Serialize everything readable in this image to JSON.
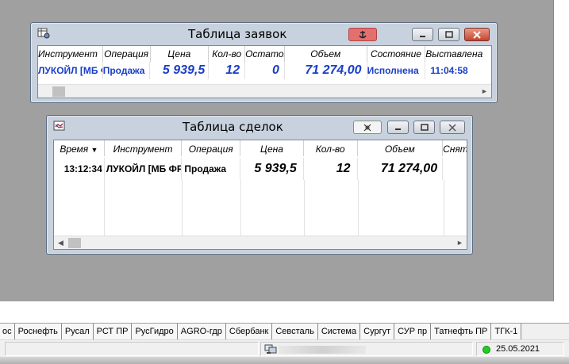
{
  "orders_window": {
    "title": "Таблица заявок",
    "columns": [
      "Инструмент",
      "Операция",
      "Цена",
      "Кол-во",
      "Остаток",
      "Объем",
      "Состояние",
      "Выставлена"
    ],
    "rows": [
      {
        "instrument": "ЛУКОЙЛ [МБ ФР]",
        "operation": "Продажа",
        "price": "5 939,5",
        "qty": "12",
        "remaining": "0",
        "volume": "71 274,00",
        "state": "Исполнена",
        "placed": "11:04:58"
      }
    ],
    "colors": {
      "row_text": "#1a3ec8",
      "anchor_button": "#e46f6f"
    }
  },
  "trades_window": {
    "title": "Таблица сделок",
    "columns": [
      "Время",
      "Инструмент",
      "Операция",
      "Цена",
      "Кол-во",
      "Объем",
      "Снят"
    ],
    "sort_indicator": "▼",
    "rows": [
      {
        "time": "13:12:34",
        "instrument": "ЛУКОЙЛ [МБ ФР]",
        "operation": "Продажа",
        "price": "5 939,5",
        "qty": "12",
        "volume": "71 274,00"
      }
    ]
  },
  "tabs": [
    "ос",
    "Роснефть",
    "Русал",
    "РСТ ПР",
    "РусГидро",
    "AGRO-гдр",
    "Сбербанк",
    "Севсталь",
    "Система",
    "Сургут",
    "СУР пр",
    "Татнефть ПР",
    "ТГК-1"
  ],
  "status": {
    "date": "25.05.2021",
    "connection_color": "#1fcf1f"
  },
  "icons": {
    "orders_window": "orders-table-icon",
    "trades_window": "handshake-icon",
    "anchor": "anchor-icon",
    "pin": "pin-icon",
    "minimize": "minimize-icon",
    "maximize": "maximize-icon",
    "close": "close-icon"
  }
}
